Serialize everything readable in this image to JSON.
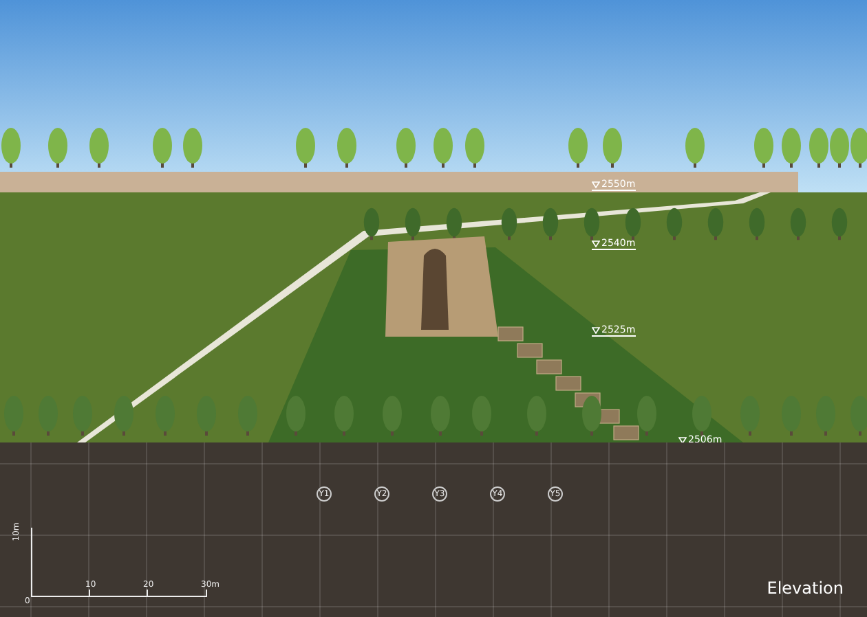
{
  "levels": [
    {
      "label": "2550m"
    },
    {
      "label": "2540m"
    },
    {
      "label": "2525m"
    },
    {
      "label": "2506m"
    }
  ],
  "grid_axes": [
    "Y1",
    "Y2",
    "Y3",
    "Y4",
    "Y5"
  ],
  "scale_bar": {
    "vertical_label": "10m",
    "ticks": [
      "0",
      "10",
      "20",
      "30m"
    ]
  },
  "title": "Elevation"
}
